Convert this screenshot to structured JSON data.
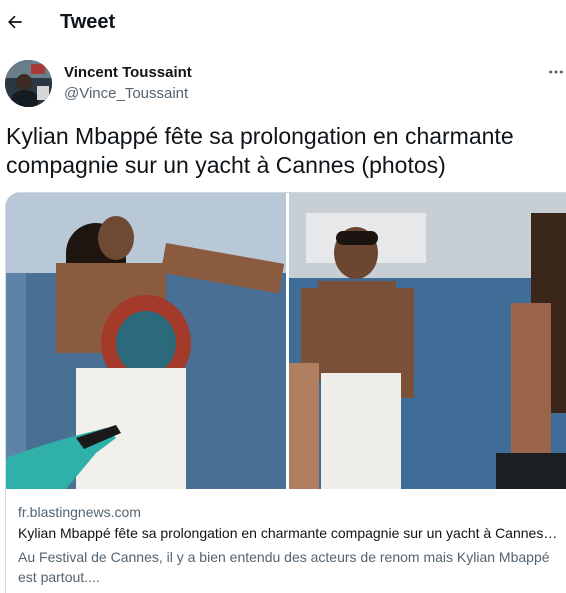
{
  "header": {
    "back_icon": "arrow-left-icon",
    "title": "Tweet"
  },
  "author": {
    "name": "Vincent Toussaint",
    "handle": "@Vince_Toussaint",
    "more_icon": "more-horizontal-icon"
  },
  "tweet": {
    "text": "Kylian Mbappé fête sa prolongation en charmante compagnie sur un yacht à Cannes (photos)"
  },
  "card": {
    "domain": "fr.blastingnews.com",
    "title": "Kylian Mbappé fête sa prolongation en charmante compagnie sur un yacht à Cannes (photos)",
    "description": "Au Festival de Cannes, il y a bien entendu des acteurs de renom mais Kylian Mbappé est partout...."
  },
  "colors": {
    "text": "#0f1419",
    "secondary": "#536471",
    "border": "#cfd9de"
  }
}
